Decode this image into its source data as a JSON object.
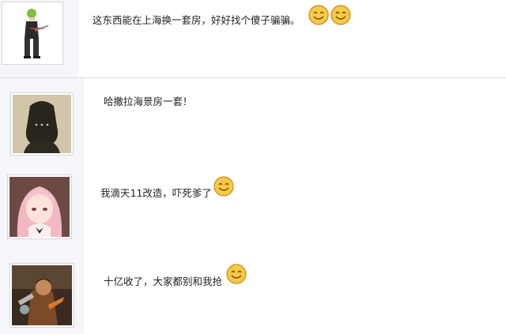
{
  "comments": [
    {
      "text": "这东西能在上海换一套房，好好找个傻子骗骗。",
      "avatar_icon": "anime-character-avatar",
      "emoji_icon": "smiley-face-emoji"
    },
    {
      "text": "哈撒拉海景房一套！",
      "avatar_icon": "dark-silhouette-avatar",
      "emoji_icon": ""
    },
    {
      "text": "我滴天11改造，吓死爹了",
      "avatar_icon": "pink-hair-anime-avatar",
      "emoji_icon": "smiley-face-emoji"
    },
    {
      "text": "十亿收了，大家都别和我抢",
      "avatar_icon": "warrior-game-avatar",
      "emoji_icon": "smiley-face-emoji"
    }
  ]
}
